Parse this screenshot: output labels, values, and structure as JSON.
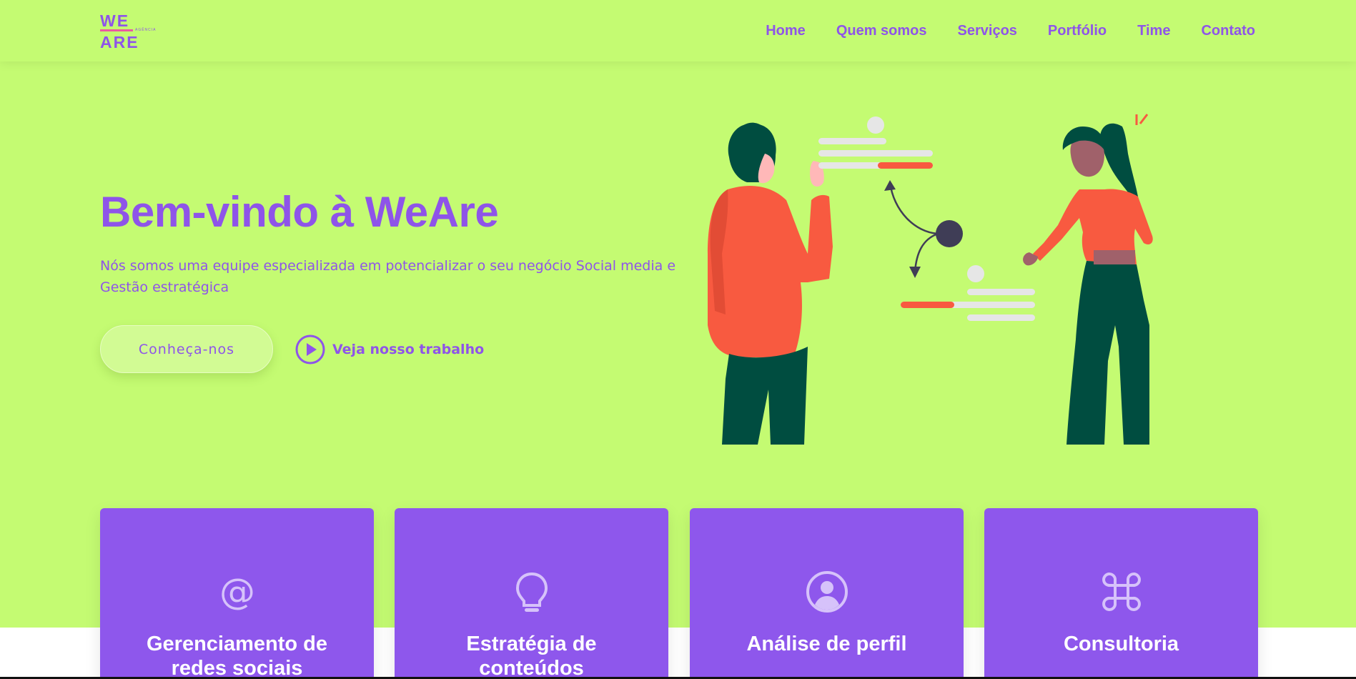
{
  "header": {
    "logo": {
      "line1": "WE",
      "line2": "ARE",
      "tagline": "AGÊNCIA"
    },
    "nav": [
      {
        "label": "Home"
      },
      {
        "label": "Quem somos"
      },
      {
        "label": "Serviços"
      },
      {
        "label": "Portfólio"
      },
      {
        "label": "Time"
      },
      {
        "label": "Contato"
      }
    ]
  },
  "hero": {
    "title": "Bem-vindo à WeAre",
    "description_line1": "Nós somos uma equipe especializada em potencializar o seu negócio Social media e",
    "description_line2": "Gestão estratégica",
    "cta_label": "Conheça-nos",
    "video_label": "Veja nosso trabalho"
  },
  "services": [
    {
      "title": "Gerenciamento de redes sociais",
      "icon": "at-sign-icon"
    },
    {
      "title": "Estratégia de conteúdos",
      "icon": "lightbulb-icon"
    },
    {
      "title": "Análise de perfil",
      "icon": "user-circle-icon"
    },
    {
      "title": "Consultoria",
      "icon": "command-icon"
    }
  ],
  "colors": {
    "background": "#c4fb72",
    "accent": "#8e54e9",
    "card": "#8e57ec",
    "illustration_shirt": "#f85a40",
    "illustration_pants": "#004d40"
  }
}
